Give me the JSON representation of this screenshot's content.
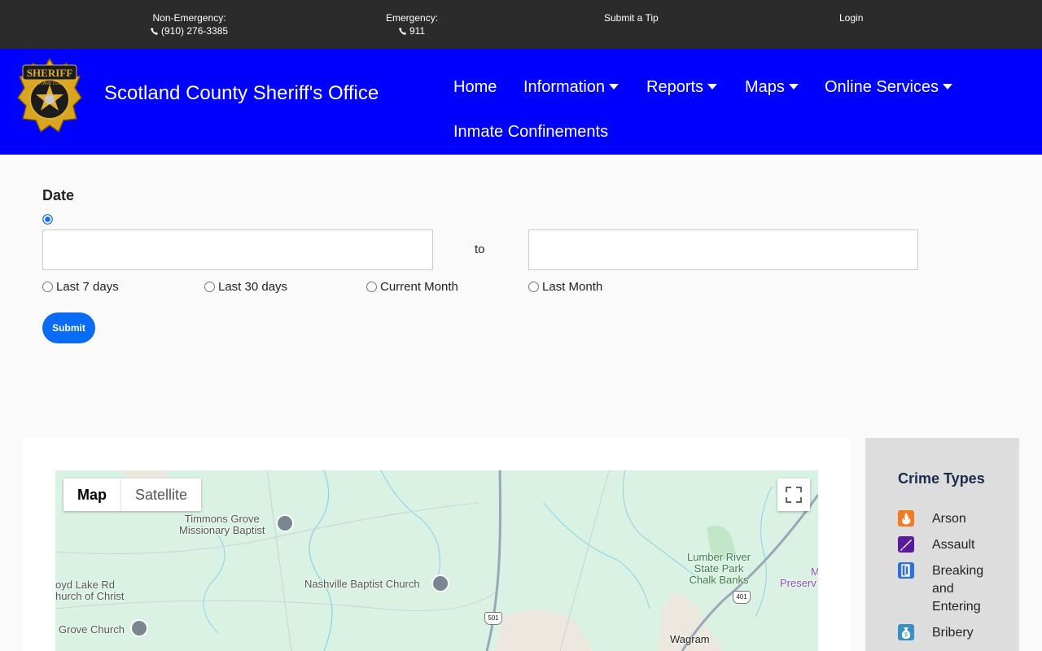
{
  "topbar": {
    "non_emergency_label": "Non-Emergency:",
    "non_emergency_phone": "(910) 276-3385",
    "emergency_label": "Emergency:",
    "emergency_phone": "911",
    "tip_label": "Submit a Tip",
    "login_label": "Login"
  },
  "header": {
    "logo_text": "SHERIFF",
    "logo_subtext": "SCOTLAND COUNTY",
    "title": "Scotland County Sheriff's Office",
    "nav": [
      {
        "label": "Home",
        "dropdown": false
      },
      {
        "label": "Information",
        "dropdown": true
      },
      {
        "label": "Reports",
        "dropdown": true
      },
      {
        "label": "Maps",
        "dropdown": true
      },
      {
        "label": "Online Services",
        "dropdown": true
      },
      {
        "label": "Inmate Confinements",
        "dropdown": false
      }
    ]
  },
  "filter": {
    "date_label": "Date",
    "from_value": "",
    "to_label": "to",
    "to_value": "",
    "quick_ranges": [
      "Last 7 days",
      "Last 30 days",
      "Current Month",
      "Last Month"
    ],
    "submit_label": "Submit"
  },
  "map": {
    "toggle_map": "Map",
    "toggle_satellite": "Satellite",
    "labels": {
      "timmons": "Timmons Grove\nMissionary Baptist",
      "nashville": "Nashville Baptist Church",
      "boyd": "oyd Lake Rd\nhurch of Christ",
      "grove": "Grove Church",
      "lumber": "Lumber River\nState Park\nChalk Banks",
      "preserve": "Preserv",
      "preserve_m": "M",
      "wagram": "Wagram",
      "r501": "501",
      "r401": "401"
    },
    "colors": {
      "land": "#d9f2e3",
      "road": "#9aa7b8",
      "water": "#8fd0e8"
    }
  },
  "sidebar": {
    "title": "Crime Types",
    "items": [
      {
        "label": "Arson",
        "icon": "fire-icon",
        "color": "#f47a20"
      },
      {
        "label": "Assault",
        "icon": "knife-icon",
        "color": "#5b1a9e"
      },
      {
        "label": "Breaking and Entering",
        "icon": "door-icon",
        "color": "#2f6fd6"
      },
      {
        "label": "Bribery",
        "icon": "money-bag-icon",
        "color": "#3a8fc4"
      }
    ]
  }
}
